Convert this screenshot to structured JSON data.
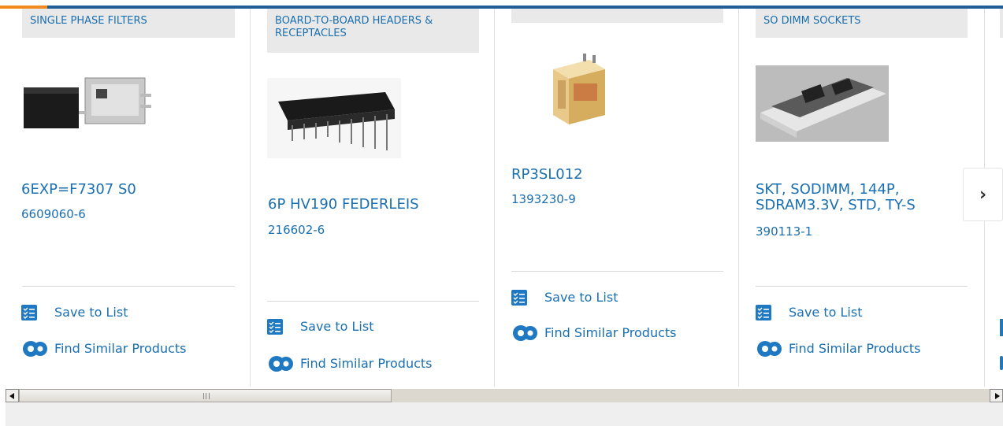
{
  "colors": {
    "link": "#1a6fb0",
    "topbar": "#1f5f99",
    "accent": "#f08a1d",
    "category_bg": "#e9e9e9"
  },
  "cards": [
    {
      "category": "SINGLE PHASE FILTERS",
      "name": "6EXP=F7307 S0",
      "part_number": "6609060-6",
      "save_label": "Save to List",
      "similar_label": "Find Similar Products",
      "image": "filter-product-image"
    },
    {
      "category": "BOARD-TO-BOARD HEADERS & RECEPTACLES",
      "name": "6P HV190 FEDERLEIS",
      "part_number": "216602-6",
      "save_label": "Save to List",
      "similar_label": "Find Similar Products",
      "image": "header-product-image"
    },
    {
      "category": "",
      "name": "RP3SL012",
      "part_number": "1393230-9",
      "save_label": "Save to List",
      "similar_label": "Find Similar Products",
      "image": "relay-product-image"
    },
    {
      "category": "SO DIMM SOCKETS",
      "name": "SKT, SODIMM, 144P, SDRAM3.3V, STD, TY-S",
      "part_number": "390113-1",
      "save_label": "Save to List",
      "similar_label": "Find Similar Products",
      "image": "sodimm-product-image"
    }
  ],
  "next_button": {
    "icon": "chevron-right-icon",
    "glyph": "›"
  },
  "scrollbar": {
    "orientation": "horizontal"
  }
}
